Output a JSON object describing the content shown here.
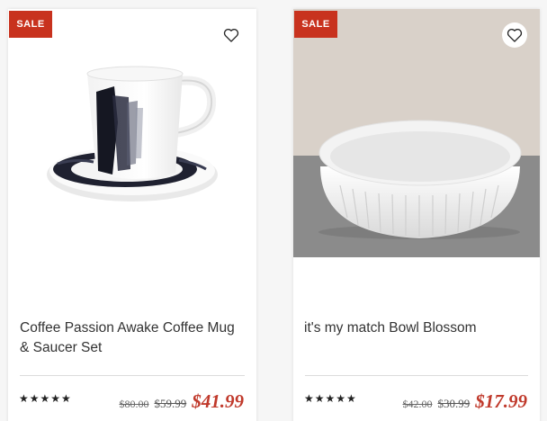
{
  "products": [
    {
      "badge": "SALE",
      "title": "Coffee Passion Awake Coffee Mug & Saucer Set",
      "rating": "★★★★★",
      "original_price": "$80.00",
      "was_price": "$59.99",
      "sale_price": "$41.99",
      "wishlist_icon": "heart-outline-icon"
    },
    {
      "badge": "SALE",
      "title": "it's my match Bowl Blossom",
      "rating": "★★★★★",
      "original_price": "$42.00",
      "was_price": "$30.99",
      "sale_price": "$17.99",
      "wishlist_icon": "heart-outline-icon"
    }
  ],
  "colors": {
    "sale": "#c8321e",
    "price": "#c0392b"
  }
}
